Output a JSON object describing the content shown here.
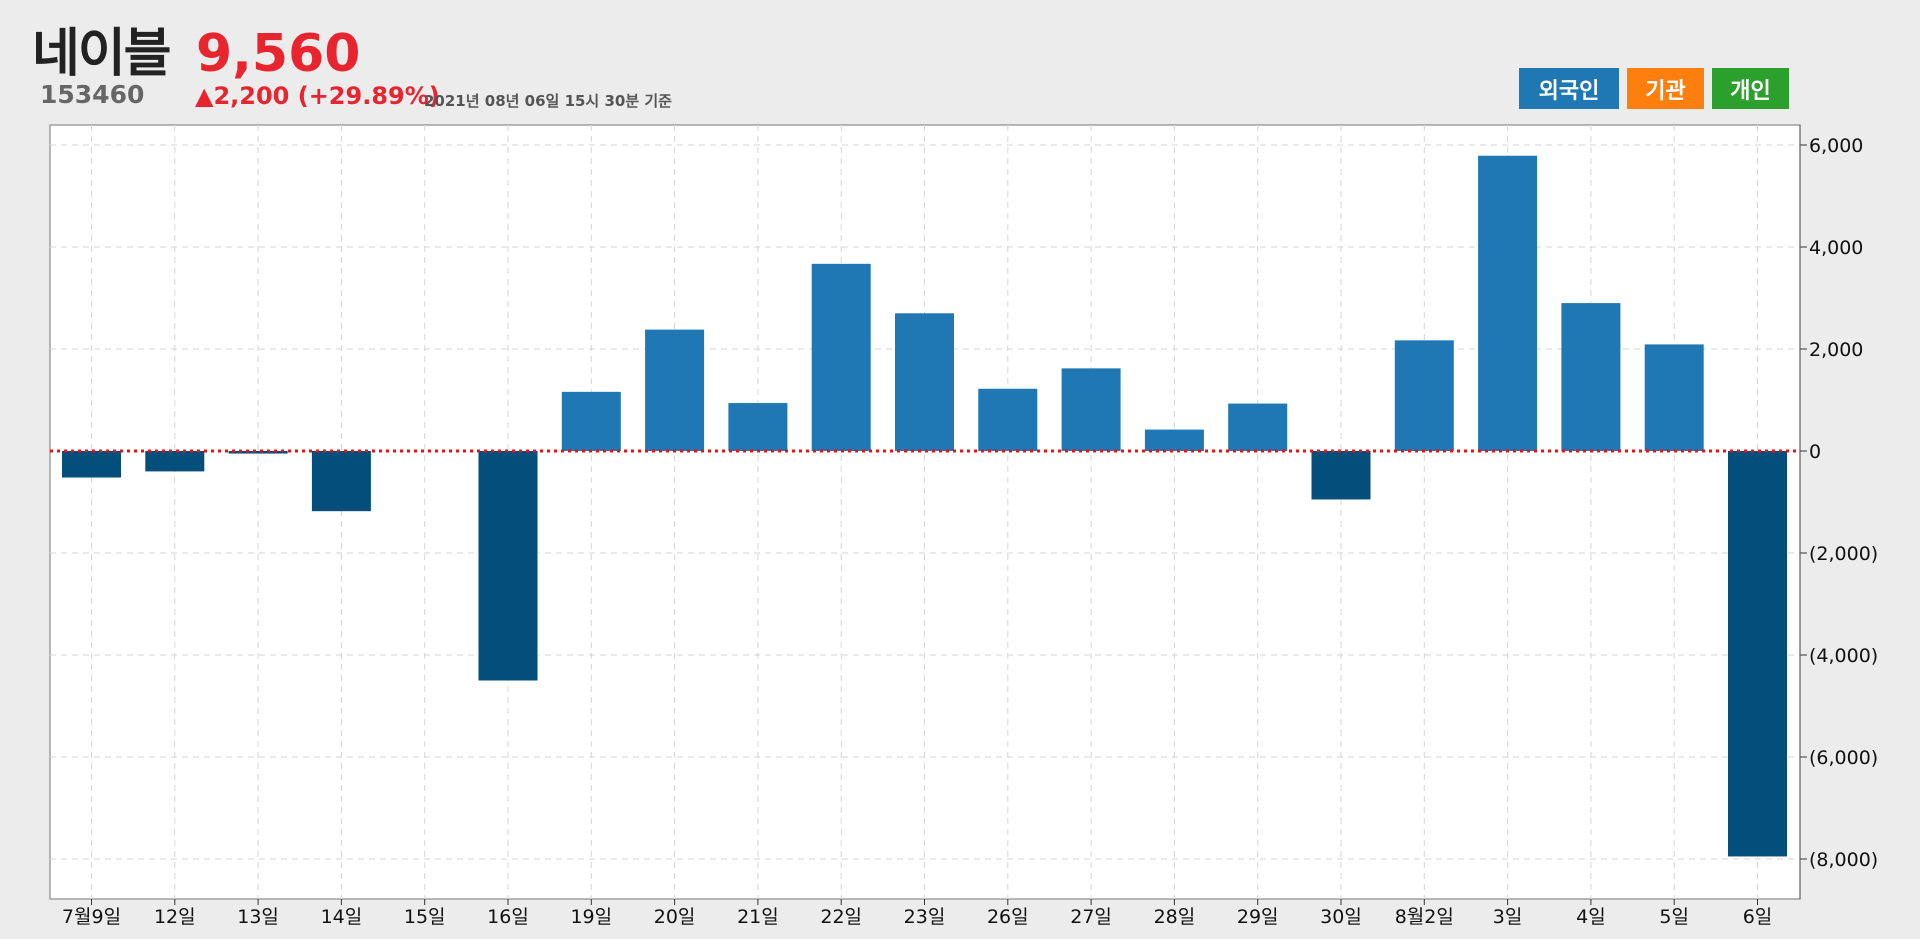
{
  "stock": {
    "name": "네이블",
    "price": "9,560",
    "code": "153460",
    "change": "▲2,200 (+29.89%)",
    "as_of": "2021년 08년 06일 15시 30분 기준"
  },
  "buttons": {
    "foreign": "외국인",
    "institution": "기관",
    "individual": "개인"
  },
  "colors": {
    "positive_bar": "#1f77b4",
    "negative_bar": "#034e7b",
    "zero_line": "#ee1111",
    "price_up": "#e8242f"
  },
  "chart_data": {
    "type": "bar",
    "categories": [
      "7월9일",
      "12일",
      "13일",
      "14일",
      "15일",
      "16일",
      "19일",
      "20일",
      "21일",
      "22일",
      "23일",
      "26일",
      "27일",
      "28일",
      "29일",
      "30일",
      "8월2일",
      "3일",
      "4일",
      "5일",
      "6일"
    ],
    "values": [
      -520,
      -400,
      -50,
      -1180,
      0,
      -4500,
      1160,
      2380,
      940,
      3670,
      2700,
      1220,
      1620,
      420,
      930,
      -950,
      2170,
      5790,
      2900,
      2090,
      -7950
    ],
    "ylim": [
      -8800,
      6400
    ],
    "yticks": [
      6000,
      4000,
      2000,
      0,
      -2000,
      -4000,
      -6000,
      -8000
    ],
    "ytick_labels": [
      "6,000",
      "4,000",
      "2,000",
      "0",
      "(2,000)",
      "(4,000)",
      "(6,000)",
      "(8,000)"
    ],
    "grid": true,
    "y_axis_side": "right",
    "zero_line_style": "dotted"
  }
}
